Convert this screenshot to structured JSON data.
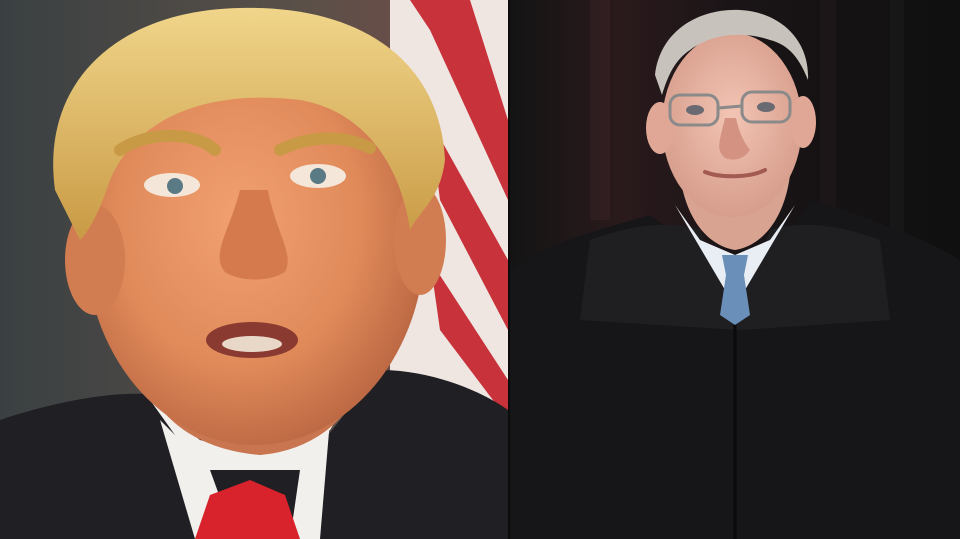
{
  "image": {
    "layout": "side-by-side-photo-composite",
    "panels": [
      {
        "subject": "man-with-blond-hair-dark-suit-red-tie",
        "background": "american-flag-stripes",
        "colors": {
          "hair": "#d9b45a",
          "skin": "#e08a5a",
          "suit": "#1f1f24",
          "shirt": "#f2f0ec",
          "tie": "#d8222c",
          "flag_red": "#c8323a",
          "flag_white": "#efe6e2"
        }
      },
      {
        "subject": "older-man-in-black-judicial-robe-with-glasses",
        "background": "dark-curtain",
        "colors": {
          "hair": "#c7c2bb",
          "skin": "#e9b6a6",
          "robe": "#161618",
          "shirt": "#e9eef4",
          "tie": "#6a8fb8",
          "curtain": "#2a1a1c"
        }
      }
    ],
    "divider_color": "#0b0b0b"
  }
}
